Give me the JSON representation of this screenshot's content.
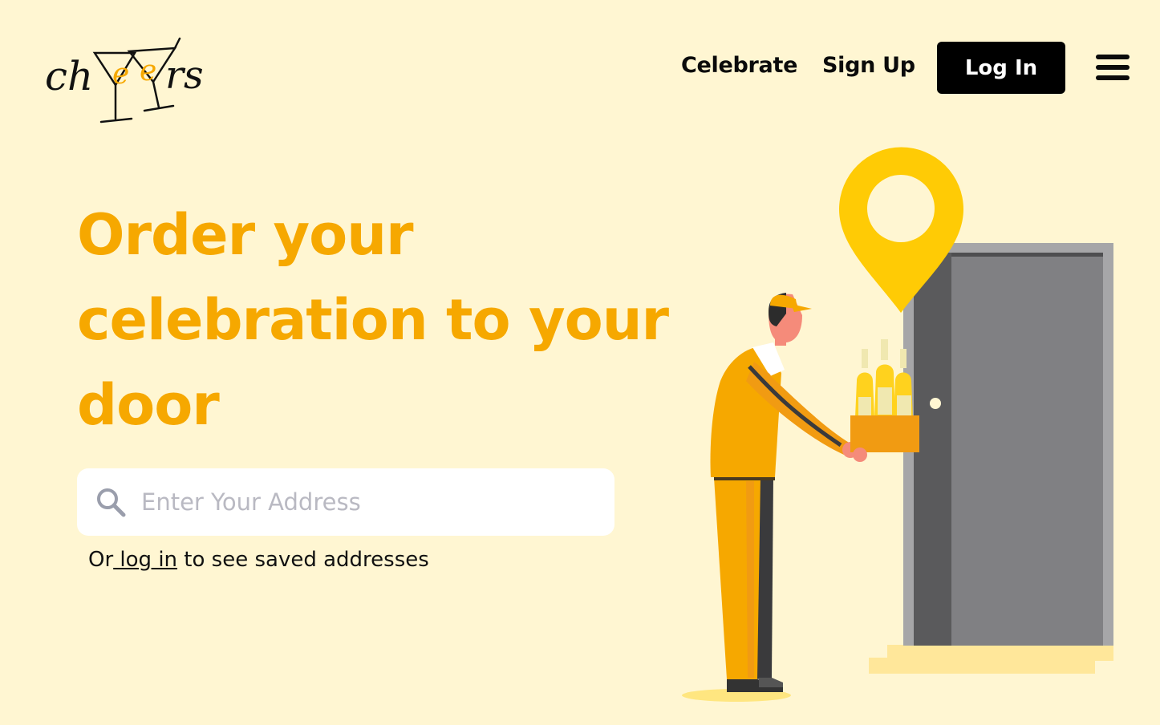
{
  "brand": {
    "logo_text": "cheers",
    "accent": "#F6A800"
  },
  "nav": {
    "celebrate_label": "Celebrate",
    "signup_label": "Sign Up",
    "login_label": "Log In",
    "menu_icon": "hamburger-menu-icon"
  },
  "hero": {
    "headline": "Order your celebration to your door",
    "search_placeholder": "Enter Your Address",
    "search_icon": "search-icon",
    "hint_prefix": "Or",
    "hint_link": " log in",
    "hint_suffix": " to see saved addresses"
  },
  "colors": {
    "background": "#FFF6D2",
    "headline": "#F6A800",
    "pin": "#FFCB05",
    "door": "#808083",
    "button": "#000000"
  }
}
